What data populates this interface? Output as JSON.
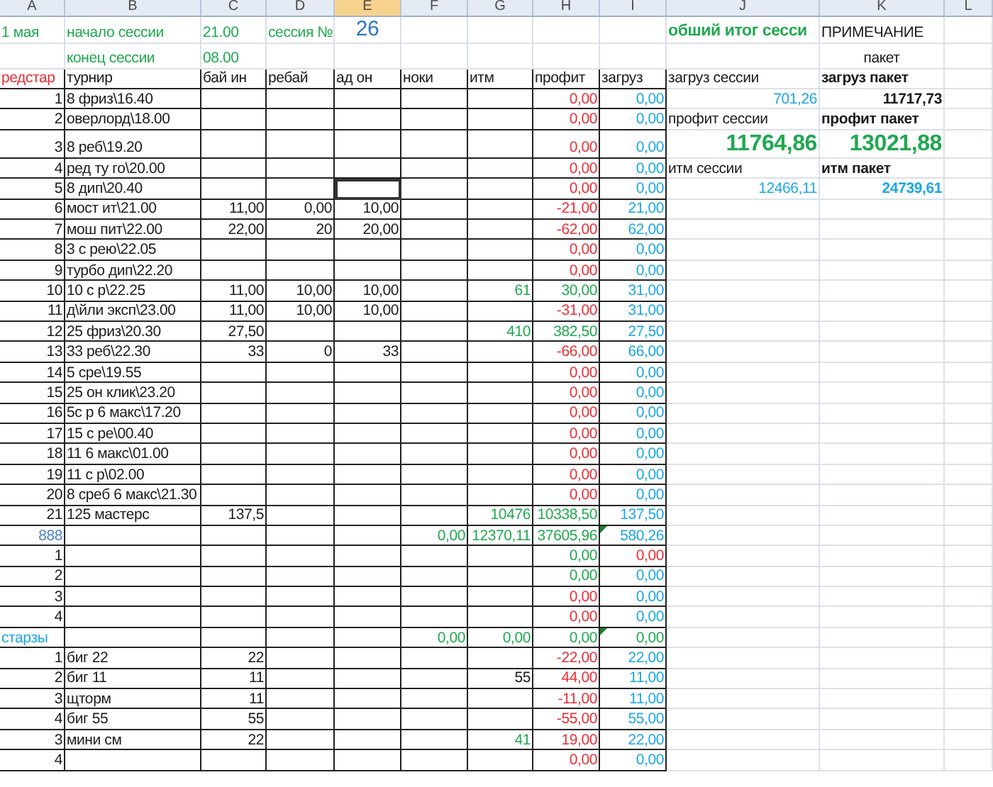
{
  "columns": [
    {
      "label": "A",
      "selected": false
    },
    {
      "label": "B",
      "selected": false
    },
    {
      "label": "C",
      "selected": false
    },
    {
      "label": "D",
      "selected": false
    },
    {
      "label": "E",
      "selected": true
    },
    {
      "label": "F",
      "selected": false
    },
    {
      "label": "G",
      "selected": false
    },
    {
      "label": "H",
      "selected": false
    },
    {
      "label": "I",
      "selected": false
    },
    {
      "label": "J",
      "selected": false
    },
    {
      "label": "K",
      "selected": false
    },
    {
      "label": "L",
      "selected": false
    }
  ],
  "rows": [
    {
      "kind": "info",
      "active": false,
      "cells": {
        "A": {
          "text": "1 мая",
          "color": "#1fa84f",
          "kind": "text"
        },
        "B": {
          "text": "начало сессии",
          "color": "#1fa84f",
          "kind": "text"
        },
        "C": {
          "text": "21.00",
          "color": "#1fa84f",
          "kind": "text"
        },
        "D": {
          "text": "сессия №",
          "color": "#1fa84f",
          "kind": "text"
        },
        "E": {
          "text": "26",
          "color": "#2b78c4",
          "kind": "large"
        },
        "J": {
          "text": "обший итог сесси",
          "color": "#1fa84f",
          "kind": "heading"
        },
        "K": {
          "text": "ПРИМЕЧАНИЕ",
          "color": "#1a1a1a",
          "kind": "text"
        }
      }
    },
    {
      "kind": "info",
      "active": false,
      "cells": {
        "B": {
          "text": "конец сессии",
          "color": "#1fa84f",
          "kind": "text"
        },
        "C": {
          "text": "08.00",
          "color": "#1fa84f",
          "kind": "text"
        },
        "K": {
          "text": "пакет",
          "color": "#1a1a1a",
          "kind": "centered"
        }
      }
    },
    {
      "kind": "table",
      "active": false,
      "cells": {
        "A": {
          "text": "редстар",
          "color": "#ee2e36",
          "kind": "text"
        },
        "B": {
          "text": "турнир",
          "color": "#1a1a1a",
          "kind": "text"
        },
        "C": {
          "text": "бай ин",
          "color": "#1a1a1a",
          "kind": "text"
        },
        "D": {
          "text": "ребай",
          "color": "#1a1a1a",
          "kind": "text"
        },
        "E": {
          "text": "ад он",
          "color": "#1a1a1a",
          "kind": "text"
        },
        "F": {
          "text": "ноки",
          "color": "#1a1a1a",
          "kind": "text"
        },
        "G": {
          "text": "итм",
          "color": "#1a1a1a",
          "kind": "text"
        },
        "H": {
          "text": "профит",
          "color": "#1a1a1a",
          "kind": "text"
        },
        "I": {
          "text": "загруз",
          "color": "#1a1a1a",
          "kind": "text"
        },
        "J": {
          "text": "загруз сессии",
          "color": "#1a1a1a",
          "kind": "text"
        },
        "K": {
          "text": "загруз пакет",
          "color": "#1a1a1a",
          "kind": "bold-text"
        }
      }
    },
    {
      "kind": "table",
      "active": false,
      "cells": {
        "A": {
          "text": "1",
          "color": "#1a1a1a",
          "kind": "number"
        },
        "B": {
          "text": "8 фриз\\16.40",
          "color": "#1a1a1a",
          "kind": "text"
        },
        "H": {
          "text": "0,00",
          "color": "#ee2e36",
          "kind": "number"
        },
        "I": {
          "text": "0,00",
          "color": "#1aa6e6",
          "kind": "number"
        },
        "J": {
          "text": "701,26",
          "color": "#1aa6e6",
          "kind": "number"
        },
        "K": {
          "text": "11717,73",
          "color": "#1a1a1a",
          "kind": "bold-number"
        }
      }
    },
    {
      "kind": "table",
      "active": false,
      "cells": {
        "A": {
          "text": "2",
          "color": "#1a1a1a",
          "kind": "number"
        },
        "B": {
          "text": "оверлорд\\18.00",
          "color": "#1a1a1a",
          "kind": "text"
        },
        "H": {
          "text": "0,00",
          "color": "#ee2e36",
          "kind": "number"
        },
        "I": {
          "text": "0,00",
          "color": "#1aa6e6",
          "kind": "number"
        },
        "J": {
          "text": "профит сессии",
          "color": "#1a1a1a",
          "kind": "text"
        },
        "K": {
          "text": "профит пакет",
          "color": "#1a1a1a",
          "kind": "bold-text"
        }
      }
    },
    {
      "kind": "table",
      "active": false,
      "cells": {
        "A": {
          "text": "3",
          "color": "#1a1a1a",
          "kind": "number"
        },
        "B": {
          "text": "8 реб\\19.20",
          "color": "#1a1a1a",
          "kind": "text"
        },
        "H": {
          "text": "0,00",
          "color": "#ee2e36",
          "kind": "number"
        },
        "I": {
          "text": "0,00",
          "color": "#1aa6e6",
          "kind": "number"
        },
        "J": {
          "text": "11764,86",
          "color": "#1fa84f",
          "kind": "total"
        },
        "K": {
          "text": "13021,88",
          "color": "#1fa84f",
          "kind": "total"
        }
      }
    },
    {
      "kind": "table",
      "active": false,
      "cells": {
        "A": {
          "text": "4",
          "color": "#1a1a1a",
          "kind": "number"
        },
        "B": {
          "text": "ред ту го\\20.00",
          "color": "#1a1a1a",
          "kind": "text"
        },
        "H": {
          "text": "0,00",
          "color": "#ee2e36",
          "kind": "number"
        },
        "I": {
          "text": "0,00",
          "color": "#1aa6e6",
          "kind": "number"
        },
        "J": {
          "text": "итм сессии",
          "color": "#1a1a1a",
          "kind": "text"
        },
        "K": {
          "text": "итм пакет",
          "color": "#1a1a1a",
          "kind": "bold-text"
        }
      }
    },
    {
      "kind": "table",
      "active": true,
      "cells": {
        "A": {
          "text": "5",
          "color": "#1a1a1a",
          "kind": "number"
        },
        "B": {
          "text": "8 дип\\20.40",
          "color": "#1a1a1a",
          "kind": "text"
        },
        "H": {
          "text": "0,00",
          "color": "#ee2e36",
          "kind": "number"
        },
        "I": {
          "text": "0,00",
          "color": "#1aa6e6",
          "kind": "number"
        },
        "J": {
          "text": "12466,11",
          "color": "#1aa6e6",
          "kind": "number"
        },
        "K": {
          "text": "24739,61",
          "color": "#1aa6e6",
          "kind": "bold-number"
        }
      }
    },
    {
      "kind": "table",
      "active": false,
      "cells": {
        "A": {
          "text": "6",
          "color": "#1a1a1a",
          "kind": "number"
        },
        "B": {
          "text": "мост ит\\21.00",
          "color": "#1a1a1a",
          "kind": "text"
        },
        "C": {
          "text": "11,00",
          "color": "#1a1a1a",
          "kind": "number"
        },
        "D": {
          "text": "0,00",
          "color": "#1a1a1a",
          "kind": "number"
        },
        "E": {
          "text": "10,00",
          "color": "#1a1a1a",
          "kind": "number"
        },
        "H": {
          "text": "-21,00",
          "color": "#ee2e36",
          "kind": "number"
        },
        "I": {
          "text": "21,00",
          "color": "#1aa6e6",
          "kind": "number"
        }
      }
    },
    {
      "kind": "table",
      "active": false,
      "cells": {
        "A": {
          "text": "7",
          "color": "#1a1a1a",
          "kind": "number"
        },
        "B": {
          "text": "мош пит\\22.00",
          "color": "#1a1a1a",
          "kind": "text"
        },
        "C": {
          "text": "22,00",
          "color": "#1a1a1a",
          "kind": "number"
        },
        "D": {
          "text": "20",
          "color": "#1a1a1a",
          "kind": "number"
        },
        "E": {
          "text": "20,00",
          "color": "#1a1a1a",
          "kind": "number"
        },
        "H": {
          "text": "-62,00",
          "color": "#ee2e36",
          "kind": "number"
        },
        "I": {
          "text": "62,00",
          "color": "#1aa6e6",
          "kind": "number"
        }
      }
    },
    {
      "kind": "table",
      "active": false,
      "cells": {
        "A": {
          "text": "8",
          "color": "#1a1a1a",
          "kind": "number"
        },
        "B": {
          "text": "3  с рею\\22.05",
          "color": "#1a1a1a",
          "kind": "text"
        },
        "H": {
          "text": "0,00",
          "color": "#ee2e36",
          "kind": "number"
        },
        "I": {
          "text": "0,00",
          "color": "#1aa6e6",
          "kind": "number"
        }
      }
    },
    {
      "kind": "table",
      "active": false,
      "cells": {
        "A": {
          "text": "9",
          "color": "#1a1a1a",
          "kind": "number"
        },
        "B": {
          "text": "турбо дип\\22.20",
          "color": "#1a1a1a",
          "kind": "text"
        },
        "H": {
          "text": "0,00",
          "color": "#ee2e36",
          "kind": "number"
        },
        "I": {
          "text": "0,00",
          "color": "#1aa6e6",
          "kind": "number"
        }
      }
    },
    {
      "kind": "table",
      "active": false,
      "cells": {
        "A": {
          "text": "10",
          "color": "#1a1a1a",
          "kind": "number"
        },
        "B": {
          "text": "10 с р\\22.25",
          "color": "#1a1a1a",
          "kind": "text"
        },
        "C": {
          "text": "11,00",
          "color": "#1a1a1a",
          "kind": "number"
        },
        "D": {
          "text": "10,00",
          "color": "#1a1a1a",
          "kind": "number"
        },
        "E": {
          "text": "10,00",
          "color": "#1a1a1a",
          "kind": "number"
        },
        "G": {
          "text": "61",
          "color": "#1fa84f",
          "kind": "number"
        },
        "H": {
          "text": "30,00",
          "color": "#1fa84f",
          "kind": "number"
        },
        "I": {
          "text": "31,00",
          "color": "#1aa6e6",
          "kind": "number"
        }
      }
    },
    {
      "kind": "table",
      "active": false,
      "cells": {
        "A": {
          "text": "11",
          "color": "#1a1a1a",
          "kind": "number"
        },
        "B": {
          "text": "д\\йли эксп\\23.00",
          "color": "#1a1a1a",
          "kind": "text"
        },
        "C": {
          "text": "11,00",
          "color": "#1a1a1a",
          "kind": "number"
        },
        "D": {
          "text": "10,00",
          "color": "#1a1a1a",
          "kind": "number"
        },
        "E": {
          "text": "10,00",
          "color": "#1a1a1a",
          "kind": "number"
        },
        "H": {
          "text": "-31,00",
          "color": "#ee2e36",
          "kind": "number"
        },
        "I": {
          "text": "31,00",
          "color": "#1aa6e6",
          "kind": "number"
        }
      }
    },
    {
      "kind": "table",
      "active": false,
      "cells": {
        "A": {
          "text": "12",
          "color": "#1a1a1a",
          "kind": "number"
        },
        "B": {
          "text": "25 фриз\\20.30",
          "color": "#1a1a1a",
          "kind": "text"
        },
        "C": {
          "text": "27,50",
          "color": "#1a1a1a",
          "kind": "number"
        },
        "G": {
          "text": "410",
          "color": "#1fa84f",
          "kind": "number"
        },
        "H": {
          "text": "382,50",
          "color": "#1fa84f",
          "kind": "number"
        },
        "I": {
          "text": "27,50",
          "color": "#1aa6e6",
          "kind": "number"
        }
      }
    },
    {
      "kind": "table",
      "active": false,
      "cells": {
        "A": {
          "text": "13",
          "color": "#1a1a1a",
          "kind": "number"
        },
        "B": {
          "text": "33 реб\\22.30",
          "color": "#1a1a1a",
          "kind": "text"
        },
        "C": {
          "text": "33",
          "color": "#1a1a1a",
          "kind": "number"
        },
        "D": {
          "text": "0",
          "color": "#1a1a1a",
          "kind": "number"
        },
        "E": {
          "text": "33",
          "color": "#1a1a1a",
          "kind": "number"
        },
        "H": {
          "text": "-66,00",
          "color": "#ee2e36",
          "kind": "number"
        },
        "I": {
          "text": "66,00",
          "color": "#1aa6e6",
          "kind": "number"
        }
      }
    },
    {
      "kind": "table",
      "active": false,
      "cells": {
        "A": {
          "text": "14",
          "color": "#1a1a1a",
          "kind": "number"
        },
        "B": {
          "text": "5 сре\\19.55",
          "color": "#1a1a1a",
          "kind": "text"
        },
        "H": {
          "text": "0,00",
          "color": "#ee2e36",
          "kind": "number"
        },
        "I": {
          "text": "0,00",
          "color": "#1aa6e6",
          "kind": "number"
        }
      }
    },
    {
      "kind": "table",
      "active": false,
      "cells": {
        "A": {
          "text": "15",
          "color": "#1a1a1a",
          "kind": "number"
        },
        "B": {
          "text": "25 он клик\\23.20",
          "color": "#1a1a1a",
          "kind": "text"
        },
        "H": {
          "text": "0,00",
          "color": "#ee2e36",
          "kind": "number"
        },
        "I": {
          "text": "0,00",
          "color": "#1aa6e6",
          "kind": "number"
        }
      }
    },
    {
      "kind": "table",
      "active": false,
      "cells": {
        "A": {
          "text": "16",
          "color": "#1a1a1a",
          "kind": "number"
        },
        "B": {
          "text": "5с р 6 макс\\17.20",
          "color": "#1a1a1a",
          "kind": "text"
        },
        "H": {
          "text": "0,00",
          "color": "#ee2e36",
          "kind": "number"
        },
        "I": {
          "text": "0,00",
          "color": "#1aa6e6",
          "kind": "number"
        }
      }
    },
    {
      "kind": "table",
      "active": false,
      "cells": {
        "A": {
          "text": "17",
          "color": "#1a1a1a",
          "kind": "number"
        },
        "B": {
          "text": "15 с ре\\00.40",
          "color": "#1a1a1a",
          "kind": "text"
        },
        "H": {
          "text": "0,00",
          "color": "#ee2e36",
          "kind": "number"
        },
        "I": {
          "text": "0,00",
          "color": "#1aa6e6",
          "kind": "number"
        }
      }
    },
    {
      "kind": "table",
      "active": false,
      "cells": {
        "A": {
          "text": "18",
          "color": "#1a1a1a",
          "kind": "number"
        },
        "B": {
          "text": "11 6 макс\\01.00",
          "color": "#1a1a1a",
          "kind": "text"
        },
        "H": {
          "text": "0,00",
          "color": "#ee2e36",
          "kind": "number"
        },
        "I": {
          "text": "0,00",
          "color": "#1aa6e6",
          "kind": "number"
        }
      }
    },
    {
      "kind": "table",
      "active": false,
      "cells": {
        "A": {
          "text": "19",
          "color": "#1a1a1a",
          "kind": "number"
        },
        "B": {
          "text": "11 с р\\02.00",
          "color": "#1a1a1a",
          "kind": "text"
        },
        "H": {
          "text": "0,00",
          "color": "#ee2e36",
          "kind": "number"
        },
        "I": {
          "text": "0,00",
          "color": "#1aa6e6",
          "kind": "number"
        }
      }
    },
    {
      "kind": "table",
      "active": false,
      "cells": {
        "A": {
          "text": "20",
          "color": "#1a1a1a",
          "kind": "number"
        },
        "B": {
          "text": "8 среб 6 макс\\21.30",
          "color": "#1a1a1a",
          "kind": "text"
        },
        "H": {
          "text": "0,00",
          "color": "#ee2e36",
          "kind": "number"
        },
        "I": {
          "text": "0,00",
          "color": "#1aa6e6",
          "kind": "number"
        }
      }
    },
    {
      "kind": "table",
      "active": false,
      "cells": {
        "A": {
          "text": "21",
          "color": "#1a1a1a",
          "kind": "number"
        },
        "B": {
          "text": "125 мастерс",
          "color": "#1a1a1a",
          "kind": "text"
        },
        "C": {
          "text": "137,5",
          "color": "#1a1a1a",
          "kind": "number"
        },
        "G": {
          "text": "10476",
          "color": "#1fa84f",
          "kind": "number"
        },
        "H": {
          "text": "10338,50",
          "color": "#1fa84f",
          "kind": "number"
        },
        "I": {
          "text": "137,50",
          "color": "#1aa6e6",
          "kind": "number"
        }
      }
    },
    {
      "kind": "table",
      "active": false,
      "cells": {
        "A": {
          "text": "888",
          "color": "#4a7ec8",
          "kind": "number"
        },
        "F": {
          "text": "0,00",
          "color": "#1fa84f",
          "kind": "number"
        },
        "G": {
          "text": "12370,11",
          "color": "#1fa84f",
          "kind": "number"
        },
        "H": {
          "text": "37605,96",
          "color": "#1fa84f",
          "kind": "number"
        },
        "I": {
          "text": "580,26",
          "color": "#1aa6e6",
          "kind": "number",
          "flag": true
        }
      }
    },
    {
      "kind": "table",
      "active": false,
      "cells": {
        "A": {
          "text": "1",
          "color": "#1a1a1a",
          "kind": "number"
        },
        "H": {
          "text": "0,00",
          "color": "#1fa84f",
          "kind": "number"
        },
        "I": {
          "text": "0,00",
          "color": "#ee2e36",
          "kind": "number"
        }
      }
    },
    {
      "kind": "table",
      "active": false,
      "cells": {
        "A": {
          "text": "2",
          "color": "#1a1a1a",
          "kind": "number"
        },
        "H": {
          "text": "0,00",
          "color": "#1fa84f",
          "kind": "number"
        },
        "I": {
          "text": "0,00",
          "color": "#1aa6e6",
          "kind": "number"
        }
      }
    },
    {
      "kind": "table",
      "active": false,
      "cells": {
        "A": {
          "text": "3",
          "color": "#1a1a1a",
          "kind": "number"
        },
        "H": {
          "text": "0,00",
          "color": "#ee2e36",
          "kind": "number"
        },
        "I": {
          "text": "0,00",
          "color": "#1aa6e6",
          "kind": "number"
        }
      }
    },
    {
      "kind": "table",
      "active": false,
      "cells": {
        "A": {
          "text": "4",
          "color": "#1a1a1a",
          "kind": "number"
        },
        "H": {
          "text": "0,00",
          "color": "#ee2e36",
          "kind": "number"
        },
        "I": {
          "text": "0,00",
          "color": "#1aa6e6",
          "kind": "number"
        }
      }
    },
    {
      "kind": "table",
      "active": false,
      "cells": {
        "A": {
          "text": "старзы",
          "color": "#1aa6e6",
          "kind": "text"
        },
        "F": {
          "text": "0,00",
          "color": "#1fa84f",
          "kind": "number"
        },
        "G": {
          "text": "0,00",
          "color": "#1fa84f",
          "kind": "number"
        },
        "H": {
          "text": "0,00",
          "color": "#1fa84f",
          "kind": "number"
        },
        "I": {
          "text": "0,00",
          "color": "#1fa84f",
          "kind": "number",
          "flag": true
        }
      }
    },
    {
      "kind": "table",
      "active": false,
      "cells": {
        "A": {
          "text": "1",
          "color": "#1a1a1a",
          "kind": "number"
        },
        "B": {
          "text": "биг 22",
          "color": "#1a1a1a",
          "kind": "text"
        },
        "C": {
          "text": "22",
          "color": "#1a1a1a",
          "kind": "number"
        },
        "H": {
          "text": "-22,00",
          "color": "#ee2e36",
          "kind": "number"
        },
        "I": {
          "text": "22,00",
          "color": "#1aa6e6",
          "kind": "number"
        }
      }
    },
    {
      "kind": "table",
      "active": false,
      "cells": {
        "A": {
          "text": "2",
          "color": "#1a1a1a",
          "kind": "number"
        },
        "B": {
          "text": "биг 11",
          "color": "#1a1a1a",
          "kind": "text"
        },
        "C": {
          "text": "11",
          "color": "#1a1a1a",
          "kind": "number"
        },
        "G": {
          "text": "55",
          "color": "#1a1a1a",
          "kind": "number"
        },
        "H": {
          "text": "44,00",
          "color": "#ee2e36",
          "kind": "number"
        },
        "I": {
          "text": "11,00",
          "color": "#1aa6e6",
          "kind": "number"
        }
      }
    },
    {
      "kind": "table",
      "active": false,
      "cells": {
        "A": {
          "text": "3",
          "color": "#1a1a1a",
          "kind": "number"
        },
        "B": {
          "text": "щторм",
          "color": "#1a1a1a",
          "kind": "text"
        },
        "C": {
          "text": "11",
          "color": "#1a1a1a",
          "kind": "number"
        },
        "H": {
          "text": "-11,00",
          "color": "#ee2e36",
          "kind": "number"
        },
        "I": {
          "text": "11,00",
          "color": "#1aa6e6",
          "kind": "number"
        }
      }
    },
    {
      "kind": "table",
      "active": false,
      "cells": {
        "A": {
          "text": "4",
          "color": "#1a1a1a",
          "kind": "number"
        },
        "B": {
          "text": "биг 55",
          "color": "#1a1a1a",
          "kind": "text"
        },
        "C": {
          "text": "55",
          "color": "#1a1a1a",
          "kind": "number"
        },
        "H": {
          "text": "-55,00",
          "color": "#ee2e36",
          "kind": "number"
        },
        "I": {
          "text": "55,00",
          "color": "#1aa6e6",
          "kind": "number"
        }
      }
    },
    {
      "kind": "table",
      "active": false,
      "cells": {
        "A": {
          "text": "3",
          "color": "#1a1a1a",
          "kind": "number"
        },
        "B": {
          "text": "мини см",
          "color": "#1a1a1a",
          "kind": "text"
        },
        "C": {
          "text": "22",
          "color": "#1a1a1a",
          "kind": "number"
        },
        "G": {
          "text": "41",
          "color": "#1fa84f",
          "kind": "number"
        },
        "H": {
          "text": "19,00",
          "color": "#ee2e36",
          "kind": "number"
        },
        "I": {
          "text": "22,00",
          "color": "#1aa6e6",
          "kind": "number"
        }
      }
    },
    {
      "kind": "table",
      "active": false,
      "cells": {
        "A": {
          "text": "4",
          "color": "#1a1a1a",
          "kind": "number"
        },
        "H": {
          "text": "0,00",
          "color": "#ee2e36",
          "kind": "number"
        },
        "I": {
          "text": "0,00",
          "color": "#1aa6e6",
          "kind": "number"
        }
      }
    }
  ]
}
